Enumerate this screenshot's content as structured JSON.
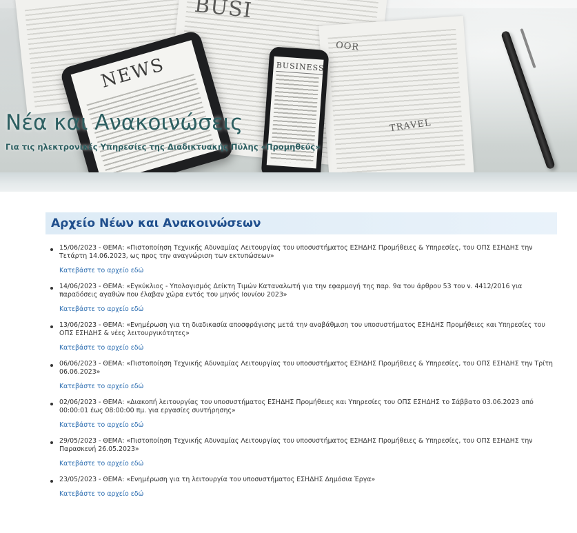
{
  "hero": {
    "title": "Νέα και Ανακοινώσεις",
    "subtitle": "Για τις ηλεκτρονικές Υπηρεσίες της Διαδικτυακής Πύλης «Προμηθεύς»",
    "image_words": {
      "tablet": "NEWS",
      "phone": "BUSINESS",
      "paper_top": "BUSI",
      "paper_right": "OOR",
      "paper_travel": "TRAVEL"
    }
  },
  "archive": {
    "heading": "Αρχείο Νέων και Ανακοινώσεων",
    "items": [
      {
        "text": "15/06/2023 - ΘΕΜΑ: «Πιστοποίηση Τεχνικής Αδυναμίας Λειτουργίας του υποσυστήματος ΕΣΗΔΗΣ Προμήθειες & Υπηρεσίες, του ΟΠΣ ΕΣΗΔΗΣ την Τετάρτη 14.06.2023, ως προς την αναγνώριση των εκτυπώσεων»",
        "link": "Κατεβάστε το αρχείο εδώ"
      },
      {
        "text": "14/06/2023 - ΘΕΜΑ: «Εγκύκλιος - Υπολογισμός Δείκτη Τιμών Καταναλωτή για την εφαρμογή της παρ. 9α του άρθρου 53 του ν. 4412/2016 για παραδόσεις αγαθών που έλαβαν χώρα εντός του μηνός Ιουνίου 2023»",
        "link": "Κατεβάστε το αρχείο εδώ"
      },
      {
        "text": "13/06/2023 - ΘΕΜΑ: «Ενημέρωση για τη διαδικασία αποσφράγισης μετά την αναβάθμιση του υποσυστήματος ΕΣΗΔΗΣ Προμήθειες και Υπηρεσίες του ΟΠΣ ΕΣΗΔΗΣ & νέες λειτουργικότητες»",
        "link": "Κατεβάστε το αρχείο εδώ"
      },
      {
        "text": "06/06/2023 - ΘΕΜΑ: «Πιστοποίηση Τεχνικής Αδυναμίας Λειτουργίας του υποσυστήματος ΕΣΗΔΗΣ Προμήθειες & Υπηρεσίες, του ΟΠΣ ΕΣΗΔΗΣ την Τρίτη 06.06.2023»",
        "link": "Κατεβάστε το αρχείο εδώ"
      },
      {
        "text": "02/06/2023 - ΘΕΜΑ: «Διακοπή λειτουργίας του υποσυστήματος ΕΣΗΔΗΣ Προμήθειες και Υπηρεσίες του ΟΠΣ ΕΣΗΔΗΣ το Σάββατο 03.06.2023 από 00:00:01 έως 08:00:00 πμ. για εργασίες συντήρησης»",
        "link": "Κατεβάστε το αρχείο εδώ"
      },
      {
        "text": "29/05/2023 - ΘΕΜΑ: «Πιστοποίηση Τεχνικής Αδυναμίας Λειτουργίας του υποσυστήματος ΕΣΗΔΗΣ Προμήθειες & Υπηρεσίες, του ΟΠΣ ΕΣΗΔΗΣ την Παρασκευή 26.05.2023»",
        "link": "Κατεβάστε το αρχείο εδώ"
      },
      {
        "text": "23/05/2023 - ΘΕΜΑ: «Ενημέρωση για τη λειτουργία του υποσυστήματος ΕΣΗΔΗΣ Δημόσια Έργα»",
        "link": "Κατεβάστε το αρχείο εδώ"
      }
    ]
  },
  "colors": {
    "title_teal": "#2d5f61",
    "heading_blue": "#1f4e8c",
    "heading_bg": "#ddebf6",
    "link_blue": "#2a6cb0",
    "body_text": "#333333"
  }
}
